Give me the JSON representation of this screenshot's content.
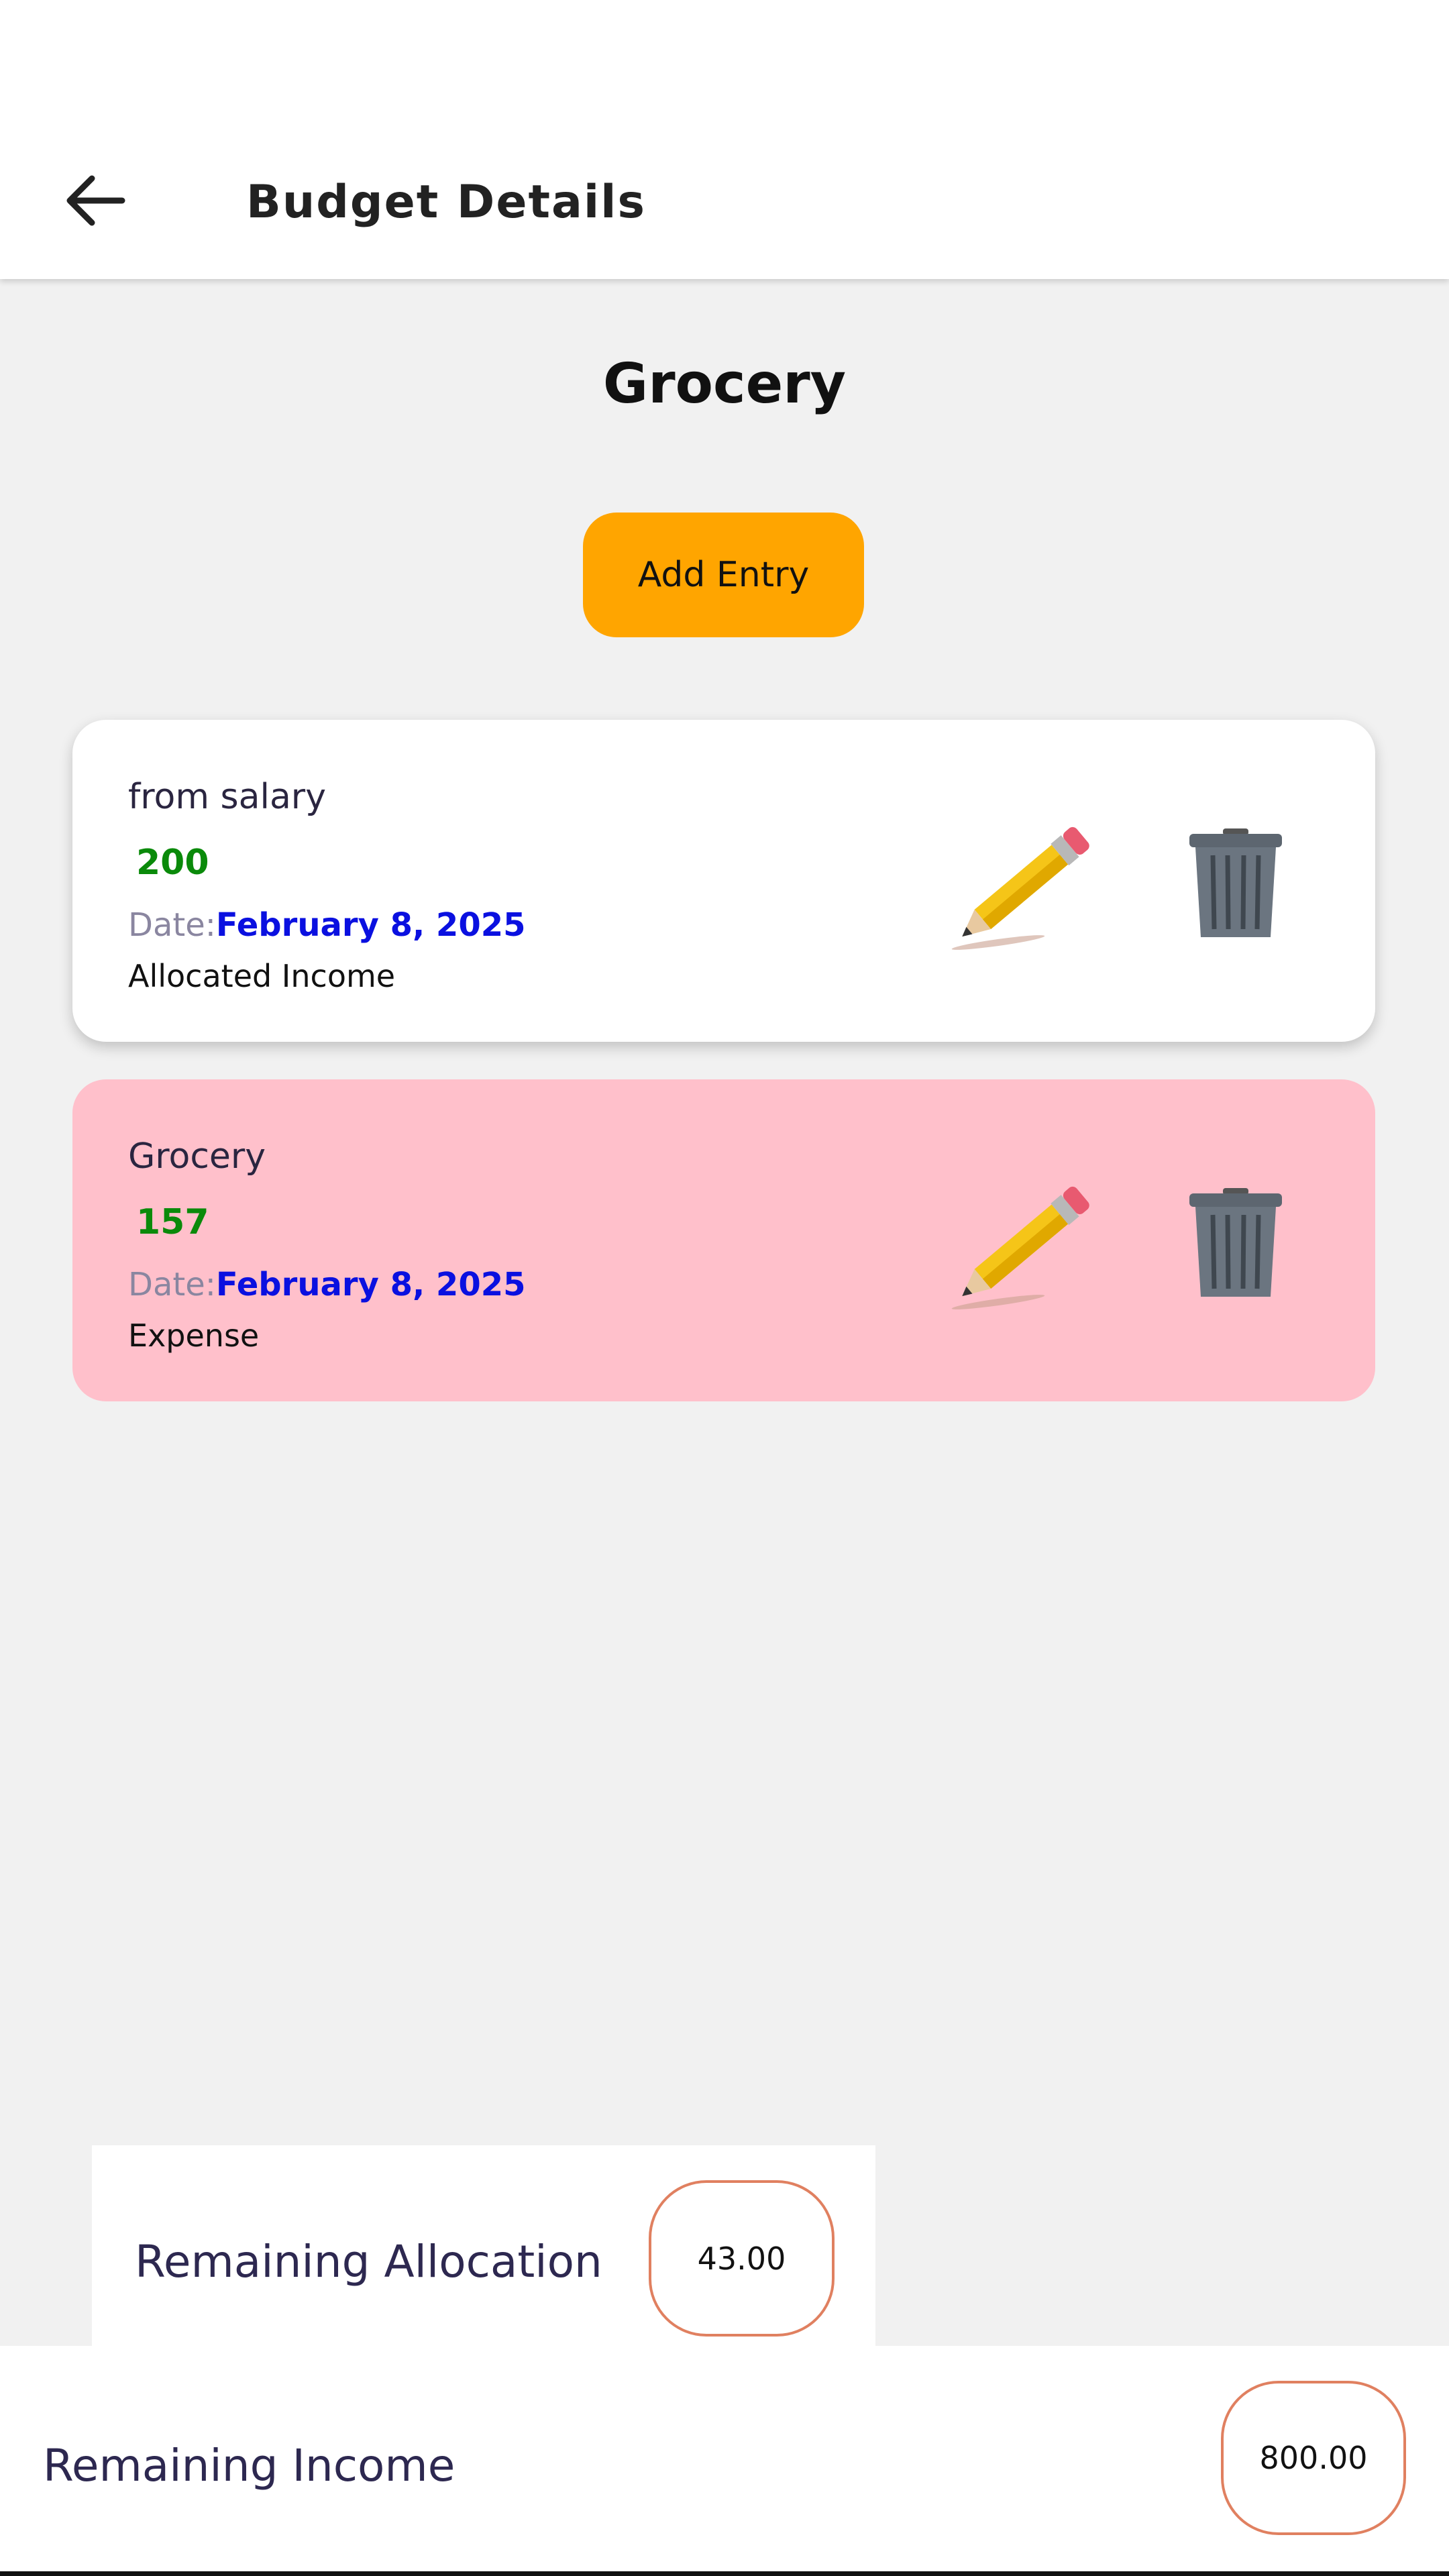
{
  "header": {
    "title": "Budget Details",
    "back_icon": "arrow-left-icon"
  },
  "budget": {
    "name": "Grocery",
    "add_entry_label": "Add Entry"
  },
  "entries": [
    {
      "description": "from salary",
      "amount": "200",
      "date_label": "Date:",
      "date": "February 8, 2025",
      "type": "Allocated Income",
      "background": "#FFFFFF"
    },
    {
      "description": "Grocery",
      "amount": "157",
      "date_label": "Date:",
      "date": "February 8, 2025",
      "type": "Expense",
      "background": "#FFC0CB"
    }
  ],
  "summary": {
    "remaining_allocation_label": "Remaining Allocation",
    "remaining_allocation_value": "43.00",
    "remaining_income_label": "Remaining Income",
    "remaining_income_value": "800.00"
  },
  "colors": {
    "accent": "#FFA500",
    "amount": "#0A8A0A",
    "date": "#0A10E0",
    "expense_card": "#FFC0CB",
    "value_border": "#E08060"
  }
}
